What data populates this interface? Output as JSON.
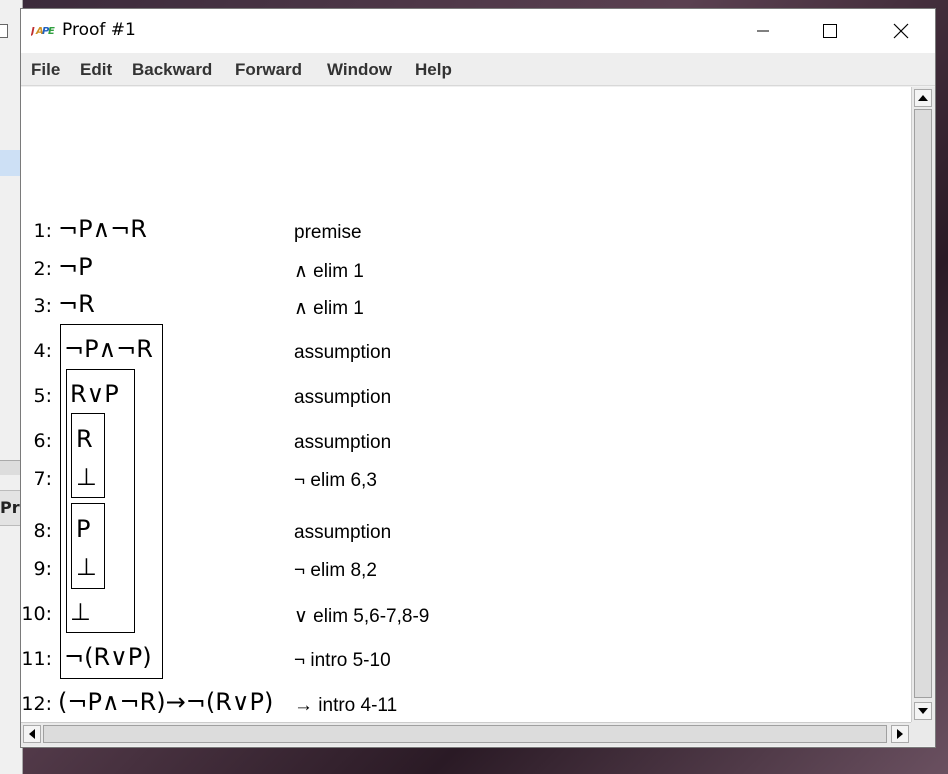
{
  "background_window": {
    "tab_label": "Pr"
  },
  "window": {
    "title": "Proof #1",
    "controls": {
      "minimize": "—",
      "maximize": "☐",
      "close": "✕"
    }
  },
  "menu": [
    "File",
    "Edit",
    "Backward",
    "Forward",
    "Window",
    "Help"
  ],
  "proof": {
    "lines": [
      {
        "num": "1:",
        "formula": "¬P∧¬R",
        "justification": "premise"
      },
      {
        "num": "2:",
        "formula": "¬P",
        "justification": "∧ elim 1"
      },
      {
        "num": "3:",
        "formula": "¬R",
        "justification": "∧ elim 1"
      },
      {
        "num": "4:",
        "formula": "¬P∧¬R",
        "justification": "assumption"
      },
      {
        "num": "5:",
        "formula": "R∨P",
        "justification": "assumption"
      },
      {
        "num": "6:",
        "formula": "R",
        "justification": "assumption"
      },
      {
        "num": "7:",
        "formula": "⊥",
        "justification": "¬ elim 6,3"
      },
      {
        "num": "8:",
        "formula": "P",
        "justification": "assumption"
      },
      {
        "num": "9:",
        "formula": "⊥",
        "justification": "¬ elim 8,2"
      },
      {
        "num": "10:",
        "formula": "⊥",
        "justification": "∨ elim 5,6-7,8-9"
      },
      {
        "num": "11:",
        "formula": "¬(R∨P)",
        "justification": "¬ intro 5-10"
      },
      {
        "num": "12:",
        "formula": "(¬P∧¬R)→¬(R∨P)",
        "justification": "→ intro 4-11"
      }
    ]
  },
  "icons": {
    "app": "jape-logo-icon",
    "scroll_up": "scroll-up-arrow-icon",
    "scroll_down": "scroll-down-arrow-icon",
    "scroll_left": "scroll-left-arrow-icon",
    "scroll_right": "scroll-right-arrow-icon"
  }
}
